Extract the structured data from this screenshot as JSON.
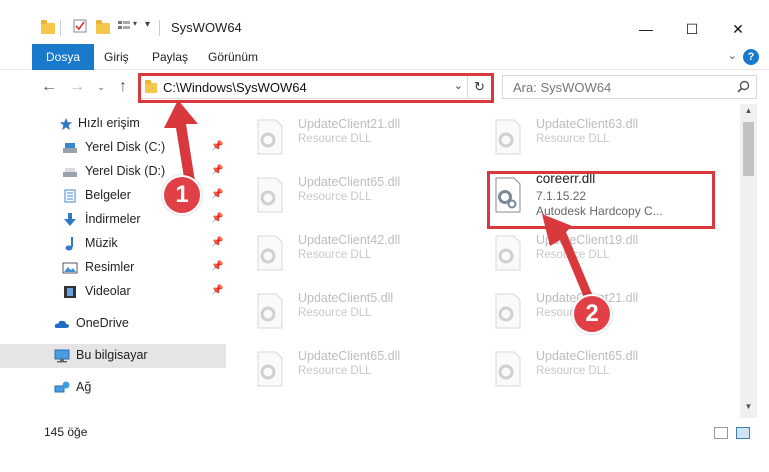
{
  "window": {
    "title": "SysWOW64",
    "controls": {
      "minimize": "—",
      "maximize": "☐",
      "close": "✕"
    }
  },
  "ribbon": {
    "tabs": [
      {
        "label": "Dosya",
        "active": true
      },
      {
        "label": "Giriş"
      },
      {
        "label": "Paylaş"
      },
      {
        "label": "Görünüm"
      }
    ],
    "help": "?"
  },
  "addressbar": {
    "path": "C:\\Windows\\SysWOW64",
    "search_placeholder": "Ara: SysWOW64"
  },
  "sidebar": {
    "items": [
      {
        "label": "Hızlı erişim",
        "icon": "star-icon",
        "pinned": false
      },
      {
        "label": "Yerel Disk (C:)",
        "icon": "drive-icon",
        "pinned": true
      },
      {
        "label": "Yerel Disk (D:)",
        "icon": "drive-icon",
        "pinned": true
      },
      {
        "label": "Belgeler",
        "icon": "documents-icon",
        "pinned": true
      },
      {
        "label": "İndirmeler",
        "icon": "download-icon",
        "pinned": true
      },
      {
        "label": "Müzik",
        "icon": "music-icon",
        "pinned": true
      },
      {
        "label": "Resimler",
        "icon": "pictures-icon",
        "pinned": true
      },
      {
        "label": "Videolar",
        "icon": "videos-icon",
        "pinned": true
      },
      {
        "label": "OneDrive",
        "icon": "onedrive-icon"
      },
      {
        "label": "Bu bilgisayar",
        "icon": "computer-icon",
        "selected": true
      },
      {
        "label": "Ağ",
        "icon": "network-icon"
      }
    ]
  },
  "files": [
    {
      "name": "UpdateClient21.dll",
      "type": "Resource DLL"
    },
    {
      "name": "UpdateClient63.dll",
      "type": "Resource DLL"
    },
    {
      "name": "UpdateClient65.dll",
      "type": "Resource DLL"
    },
    {
      "name": "coreerr.dll",
      "version": "7.1.15.22",
      "description": "Autodesk Hardcopy C...",
      "highlighted": true
    },
    {
      "name": "UpdateClient42.dll",
      "type": "Resource DLL"
    },
    {
      "name": "UpdateClient19.dll",
      "type": "Resource DLL"
    },
    {
      "name": "UpdateClient5.dll",
      "type": "Resource DLL"
    },
    {
      "name": "UpdateClient21.dll",
      "type": "Resource DLL"
    },
    {
      "name": "UpdateClient65.dll",
      "type": "Resource DLL"
    },
    {
      "name": "UpdateClient65.dll",
      "type": "Resource DLL"
    }
  ],
  "status": {
    "item_count": "145 öğe"
  },
  "annotations": {
    "marker1": "1",
    "marker2": "2",
    "color": "#d9383d"
  }
}
